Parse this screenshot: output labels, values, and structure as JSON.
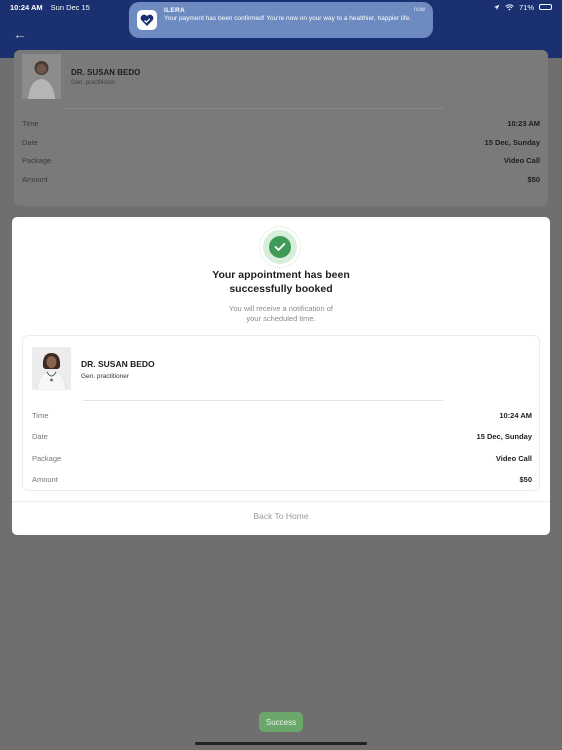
{
  "status_bar": {
    "time": "10:24 AM",
    "date": "Sun Dec 15",
    "battery": "71%"
  },
  "notification": {
    "app": "ILERA",
    "time": "now",
    "message": "Your payment has been confirmed! You're now on your way to a healthier, happier life."
  },
  "background_card": {
    "doctor_name": "DR. SUSAN BEDO",
    "doctor_role": "Gen. practitioner",
    "rows": [
      {
        "label": "Time",
        "value": "10:23 AM"
      },
      {
        "label": "Date",
        "value": "15 Dec, Sunday"
      },
      {
        "label": "Package",
        "value": "Video Call"
      },
      {
        "label": "Amount",
        "value": "$50"
      }
    ]
  },
  "modal": {
    "title_line1": "Your appointment has been",
    "title_line2": "successfully booked",
    "subtitle_line1": "You will receive a notification of",
    "subtitle_line2": "your scheduled time.",
    "doctor_name": "DR. SUSAN BEDO",
    "doctor_role": "Gen. practitioner",
    "rows": [
      {
        "label": "Time",
        "value": "10:24 AM"
      },
      {
        "label": "Date",
        "value": "15 Dec, Sunday"
      },
      {
        "label": "Package",
        "value": "Video Call"
      },
      {
        "label": "Amount",
        "value": "$50"
      }
    ],
    "back_home_label": "Back To Home"
  },
  "toast": {
    "label": "Success"
  },
  "colors": {
    "header_blue": "#1a3070",
    "success_green": "#3f9a57",
    "toast_green": "#6ba66a",
    "notif_blue": "#6d8bc0"
  }
}
